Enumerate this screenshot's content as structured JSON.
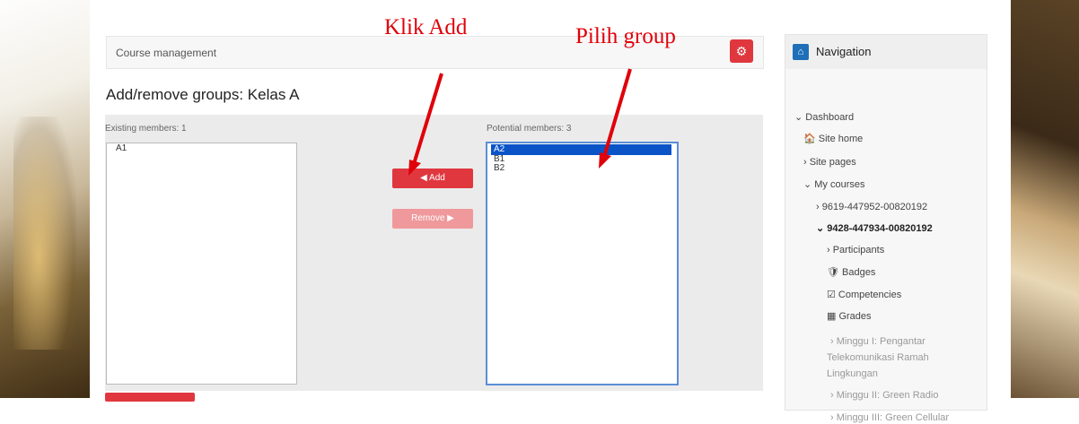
{
  "header": {
    "course_management": "Course management",
    "gear_icon": "gear-icon"
  },
  "page_title": "Add/remove groups: Kelas A",
  "existing": {
    "label": "Existing members: 1",
    "options": [
      "A1"
    ]
  },
  "potential": {
    "label": "Potential members: 3",
    "options": [
      "A2",
      "B1",
      "B2"
    ],
    "selected": "A2"
  },
  "buttons": {
    "add": "◀ Add",
    "remove": "Remove ▶"
  },
  "annotations": {
    "klik_add": "Klik Add",
    "pilih_group": "Pilih group"
  },
  "navigation": {
    "title": "Navigation",
    "items": [
      "⌄ Dashboard",
      "🏠 Site home",
      "› Site pages",
      "⌄ My courses",
      "› 9619-447952-00820192",
      "⌄ 9428-447934-00820192",
      "› Participants",
      "🛡 Badges",
      "☑ Competencies",
      "▦ Grades",
      "› Minggu I: Pengantar",
      "Telekomunikasi Ramah",
      "Lingkungan",
      "› Minggu II: Green Radio",
      "› Minggu III: Green Cellular"
    ]
  },
  "colors": {
    "accent_red": "#e0373f",
    "nav_blue": "#1e6fb8",
    "selection_blue": "#0a54c8",
    "annotation_red": "#e0000a"
  }
}
